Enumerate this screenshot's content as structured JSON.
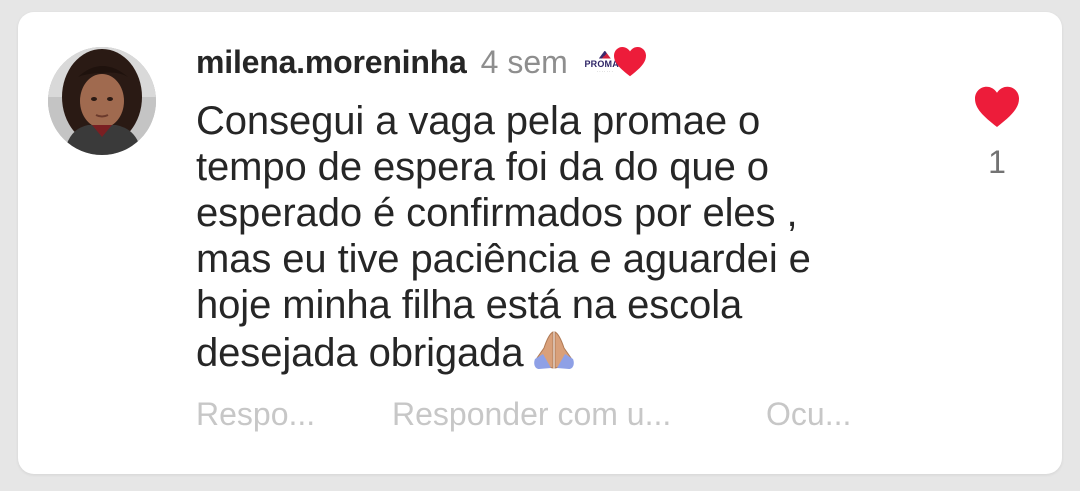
{
  "comment": {
    "username": "milena.moreninha",
    "time_ago": "4 sem",
    "creator_like_logo_text": "PROMAE",
    "text": "Consegui a vaga pela promae o\ntempo de espera foi da do que o\nesperado é confirmados por eles ,\nmas eu tive paciência e aguardei e\nhoje minha filha está na escola\ndesejada obrigada",
    "emoji": "folded-hands-icon",
    "like_count": "1"
  },
  "actions": {
    "reply_label": "Respo...",
    "reply_gif_label": "Responder com u...",
    "hide_label": "Ocu..."
  },
  "colors": {
    "heart": "#ed1c3a",
    "username": "#262626",
    "muted": "#8e8e8e",
    "action_text": "#c7c7c7",
    "background": "#e6e6e6",
    "card": "#ffffff"
  }
}
